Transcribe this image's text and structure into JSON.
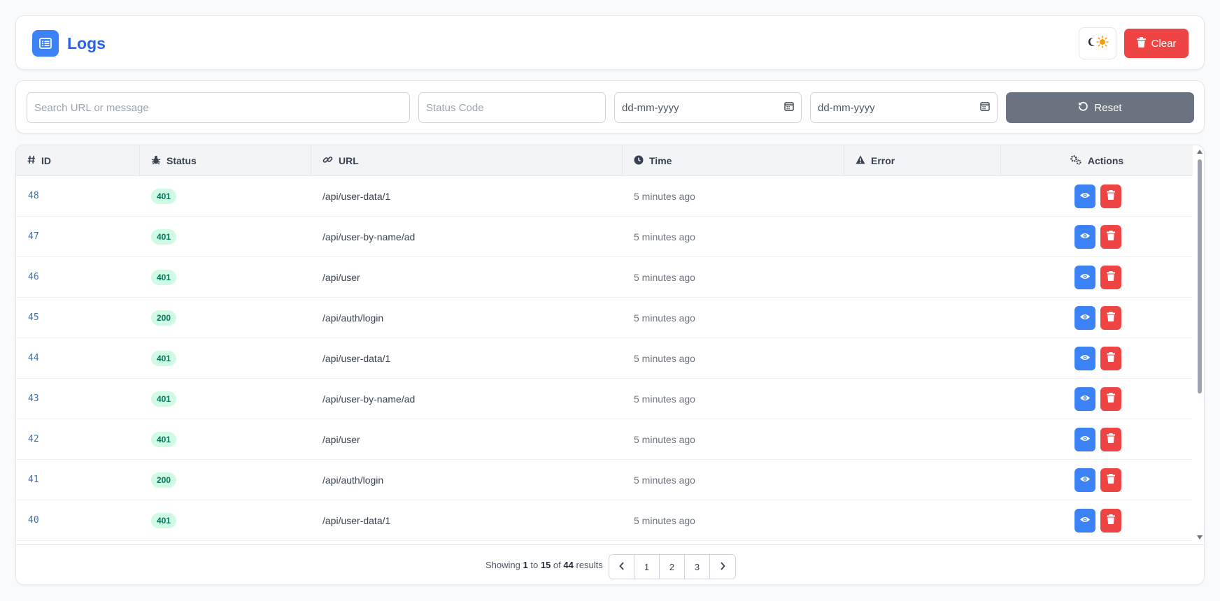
{
  "header": {
    "title": "Logs",
    "logo_icon": "list-icon",
    "theme_icons": [
      "moon-icon",
      "sun-icon"
    ],
    "clear_label": "Clear"
  },
  "filters": {
    "search_placeholder": "Search URL or message",
    "status_placeholder": "Status Code",
    "date_from_placeholder": "dd-mm-yyyy",
    "date_to_placeholder": "dd-mm-yyyy",
    "reset_label": "Reset"
  },
  "table": {
    "columns": [
      {
        "label": "ID",
        "icon": "hash-icon"
      },
      {
        "label": "Status",
        "icon": "bug-icon"
      },
      {
        "label": "URL",
        "icon": "link-icon"
      },
      {
        "label": "Time",
        "icon": "clock-icon"
      },
      {
        "label": "Error",
        "icon": "warning-icon"
      },
      {
        "label": "Actions",
        "icon": "cogs-icon"
      }
    ],
    "rows": [
      {
        "id": "48",
        "status": "401",
        "url": "/api/user-data/1",
        "time": "5 minutes ago",
        "error": ""
      },
      {
        "id": "47",
        "status": "401",
        "url": "/api/user-by-name/ad",
        "time": "5 minutes ago",
        "error": ""
      },
      {
        "id": "46",
        "status": "401",
        "url": "/api/user",
        "time": "5 minutes ago",
        "error": ""
      },
      {
        "id": "45",
        "status": "200",
        "url": "/api/auth/login",
        "time": "5 minutes ago",
        "error": ""
      },
      {
        "id": "44",
        "status": "401",
        "url": "/api/user-data/1",
        "time": "5 minutes ago",
        "error": ""
      },
      {
        "id": "43",
        "status": "401",
        "url": "/api/user-by-name/ad",
        "time": "5 minutes ago",
        "error": ""
      },
      {
        "id": "42",
        "status": "401",
        "url": "/api/user",
        "time": "5 minutes ago",
        "error": ""
      },
      {
        "id": "41",
        "status": "200",
        "url": "/api/auth/login",
        "time": "5 minutes ago",
        "error": ""
      },
      {
        "id": "40",
        "status": "401",
        "url": "/api/user-data/1",
        "time": "5 minutes ago",
        "error": ""
      }
    ]
  },
  "pagination": {
    "showing_prefix": "Showing",
    "from": "1",
    "to_word": "to",
    "to": "15",
    "of_word": "of",
    "total": "44",
    "results_word": "results",
    "pages": [
      "1",
      "2",
      "3"
    ]
  },
  "colors": {
    "primary": "#3b82f6",
    "danger": "#ef4444",
    "neutral": "#6b7280",
    "badge_bg": "#d1fae5",
    "badge_text": "#047857"
  }
}
